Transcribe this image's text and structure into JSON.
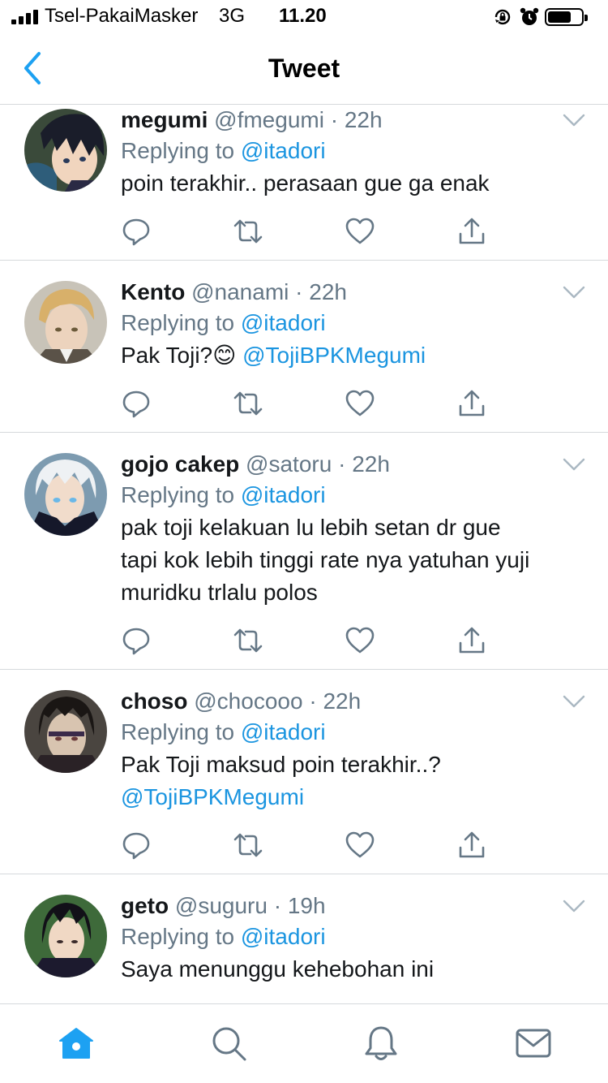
{
  "status_bar": {
    "carrier": "Tsel-PakaiMasker",
    "network": "3G",
    "time": "11.20"
  },
  "nav": {
    "title": "Tweet"
  },
  "icons": {
    "back": "chevron-left-icon",
    "reply": "reply-icon",
    "retweet": "retweet-icon",
    "like": "heart-icon",
    "share": "share-icon",
    "tabs": [
      "home-icon",
      "search-icon",
      "notifications-icon",
      "messages-icon"
    ]
  },
  "colors": {
    "accent": "#1da1f2",
    "link": "#1b95e0",
    "muted": "#657786",
    "divider": "#d6d9dc"
  },
  "tweets": [
    {
      "name": "megumi",
      "handle": "@fmegumi",
      "time": "22h",
      "replying_label": "Replying to",
      "replying_to": "@itadori",
      "text": "poin terakhir.. perasaan gue ga enak"
    },
    {
      "name": "Kento",
      "handle": "@nanami",
      "time": "22h",
      "replying_label": "Replying to",
      "replying_to": "@itadori",
      "text": "Pak Toji?",
      "emoji": "😊",
      "mention": "@TojiBPKMegumi"
    },
    {
      "name": "gojo cakep",
      "handle": "@satoru",
      "time": "22h",
      "replying_label": "Replying to",
      "replying_to": "@itadori",
      "text_lines": [
        "pak toji kelakuan lu lebih setan dr gue",
        "tapi kok lebih tinggi rate nya yatuhan yuji",
        "muridku trlalu polos"
      ]
    },
    {
      "name": "choso",
      "handle": "@chocooo",
      "time": "22h",
      "replying_label": "Replying to",
      "replying_to": "@itadori",
      "text": "Pak Toji maksud poin terakhir..?",
      "mention": "@TojiBPKMegumi"
    },
    {
      "name": "geto",
      "handle": "@suguru",
      "time": "19h",
      "replying_label": "Replying to",
      "replying_to": "@itadori",
      "text": "Saya menunggu kehebohan ini"
    }
  ]
}
